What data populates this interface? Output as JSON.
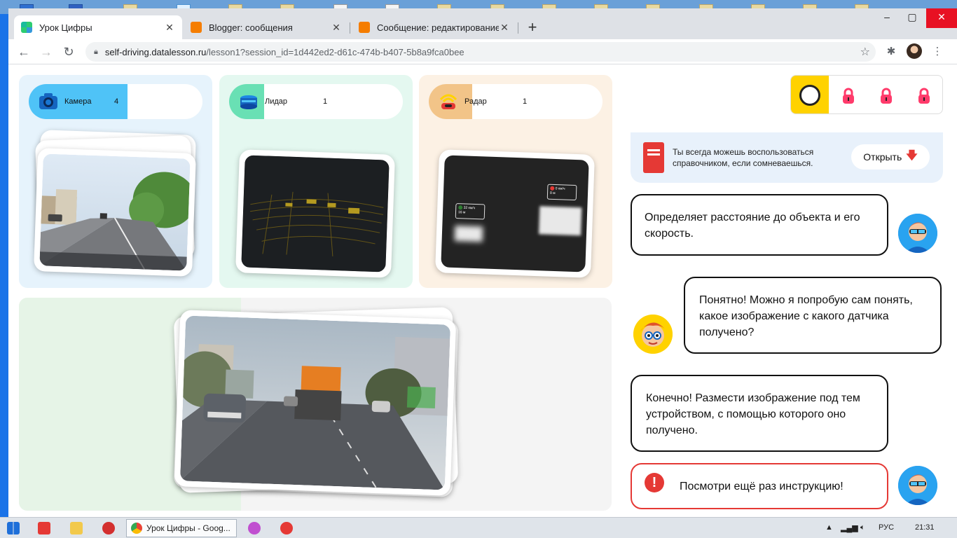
{
  "browser": {
    "tabs": [
      {
        "title": "Урок Цифры",
        "active": true
      },
      {
        "title": "Blogger: сообщения",
        "active": false
      },
      {
        "title": "Сообщение: редактирование",
        "active": false
      }
    ],
    "url_host": "self-driving.datalesson.ru",
    "url_path": "/lesson1?session_id=1d442ed2-d61c-474b-b407-5b8a9fca0bee"
  },
  "sensors": [
    {
      "name": "Камера",
      "count": "4",
      "color": "#4fc3f7"
    },
    {
      "name": "Лидар",
      "count": "1",
      "color": "#69e0b4"
    },
    {
      "name": "Радар",
      "count": "1",
      "color": "#f2c488"
    }
  ],
  "radar_labels": {
    "left_speed": "32 км/ч",
    "left_dist": "16 м",
    "right_speed": "0 км/ч",
    "right_dist": "8 м"
  },
  "help": {
    "text": "Ты всегда можешь воспользоваться справочником, если сомневаешься.",
    "open_label": "Открыть"
  },
  "chat": [
    {
      "text": "Определяет расстояние до объекта и его скорость.",
      "side": "left"
    },
    {
      "text": "Понятно! Можно я попробую сам понять, какое изображение с какого датчика получено?",
      "side": "right"
    },
    {
      "text": "Конечно! Размести изображение под тем устройством, с помощью которого оно получено.",
      "side": "left"
    },
    {
      "text": "Посмотри ещё раз инструкцию!",
      "side": "left",
      "warning": true
    }
  ],
  "taskbar": {
    "active_app": "Урок Цифры - Goog...",
    "lang": "РУС",
    "time": "21:31"
  },
  "colors": {
    "accent_yellow": "#ffd200",
    "warn_red": "#e53935",
    "lock_pink": "#ff3b6b"
  }
}
